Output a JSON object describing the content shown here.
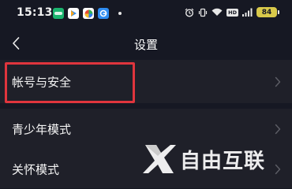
{
  "status_bar": {
    "time": "15:13",
    "battery": "84",
    "hd_label": "HD",
    "app_icons": [
      "app-icon-green",
      "app-icon-play",
      "app-icon-colorful",
      "app-icon-blue"
    ],
    "system_icons": [
      "alarm-icon",
      "vibrate-icon",
      "wifi-icon",
      "hd-icon",
      "signal-icon",
      "battery-icon"
    ]
  },
  "header": {
    "title": "设置",
    "back_icon": "chevron-left-icon"
  },
  "settings_items": [
    {
      "label": "帐号与安全",
      "highlighted": true
    },
    {
      "label": "青少年模式",
      "highlighted": false
    },
    {
      "label": "关怀模式",
      "highlighted": false
    }
  ],
  "watermark": {
    "text": "自由互联",
    "logo": "x-logo-icon"
  },
  "colors": {
    "background": "#161823",
    "item_background": "#1f2029",
    "highlight_border": "#e0353d",
    "battery": "#d9c94a"
  }
}
